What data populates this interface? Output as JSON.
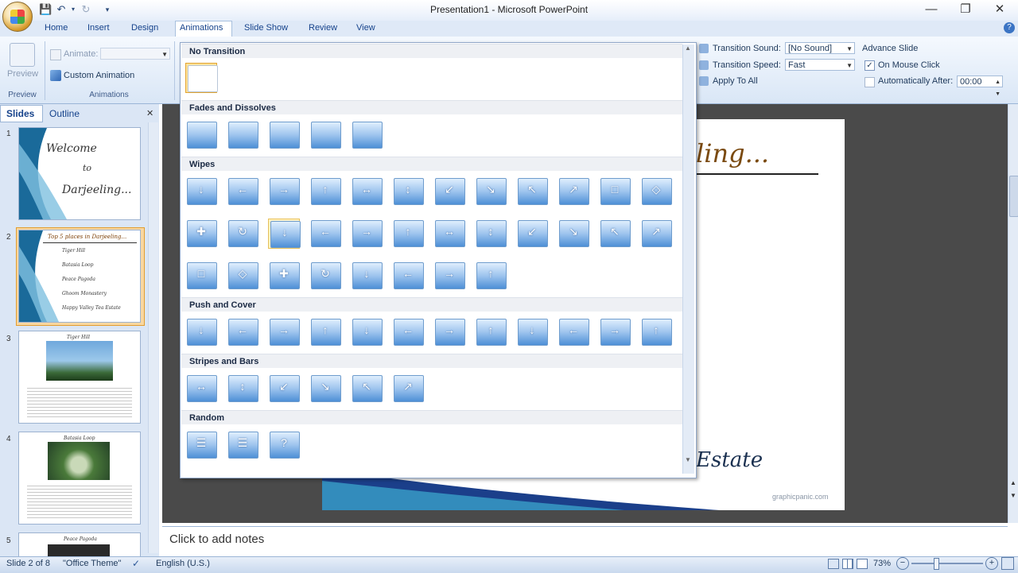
{
  "window": {
    "title": "Presentation1 - Microsoft PowerPoint"
  },
  "tabs": [
    "Home",
    "Insert",
    "Design",
    "Animations",
    "Slide Show",
    "Review",
    "View"
  ],
  "ribbon": {
    "preview": {
      "label": "Preview",
      "group": "Preview"
    },
    "animations": {
      "animate_label": "Animate:",
      "custom_animation": "Custom Animation",
      "group": "Animations"
    },
    "transition": {
      "sound_label": "Transition Sound:",
      "sound_value": "[No Sound]",
      "speed_label": "Transition Speed:",
      "speed_value": "Fast",
      "apply_all": "Apply To All"
    },
    "advance": {
      "title": "Advance Slide",
      "on_mouse_click": "On Mouse Click",
      "auto_after": "Automatically After:",
      "auto_value": "00:00"
    }
  },
  "panel": {
    "tab_slides": "Slides",
    "tab_outline": "Outline",
    "thumbs": [
      {
        "num": "1",
        "lines": [
          "Welcome",
          "to",
          "Darjeeling..."
        ]
      },
      {
        "num": "2",
        "title": "Top 5 places in Darjeeling...",
        "bullets": [
          "Tiger Hill",
          "Batasia Loop",
          "Peace Pagoda",
          "Ghoom Monastery",
          "Happy Valley Tea Estate"
        ]
      },
      {
        "num": "3",
        "title": "Tiger Hill"
      },
      {
        "num": "4",
        "title": "Batasia Loop"
      },
      {
        "num": "5",
        "title": "Peace Pagoda"
      }
    ]
  },
  "slide": {
    "title_fragment": "ling...",
    "bottom_fragment": "Estate",
    "credit": "graphicpanic.com"
  },
  "notes": {
    "placeholder": "Click to add notes"
  },
  "status": {
    "slide_info": "Slide 2 of 8",
    "theme": "\"Office Theme\"",
    "language": "English (U.S.)",
    "zoom": "73%"
  },
  "gallery": {
    "sections": [
      "No Transition",
      "Fades and Dissolves",
      "Wipes",
      "Push and Cover",
      "Stripes and Bars",
      "Random"
    ]
  },
  "colors": {
    "accent": "#15428b",
    "selection": "#e9a33a",
    "ribbon": "#dbe6f5"
  }
}
